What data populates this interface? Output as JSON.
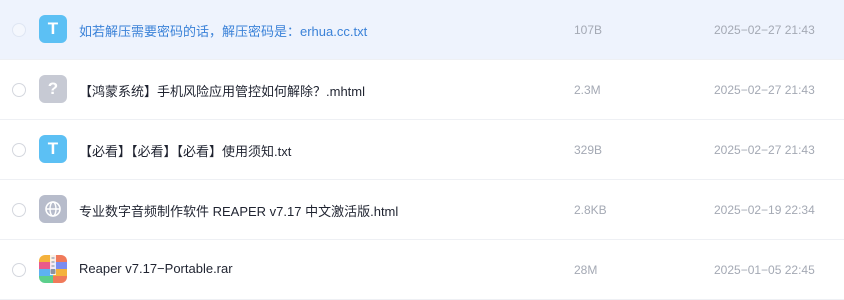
{
  "files": [
    {
      "name": "如若解压需要密码的话，解压密码是：erhua.cc.txt",
      "size": "107B",
      "date": "2025−02−27 21:43",
      "type": "txt",
      "icon_glyph": "T",
      "icon": "text-file-icon"
    },
    {
      "name": "【鸿蒙系统】手机风险应用管控如何解除？.mhtml",
      "size": "2.3M",
      "date": "2025−02−27 21:43",
      "type": "unknown",
      "icon_glyph": "?",
      "icon": "unknown-file-icon"
    },
    {
      "name": "【必看】【必看】【必看】使用须知.txt",
      "size": "329B",
      "date": "2025−02−27 21:43",
      "type": "txt",
      "icon_glyph": "T",
      "icon": "text-file-icon"
    },
    {
      "name": "专业数字音频制作软件 REAPER v7.17 中文激活版.html",
      "size": "2.8KB",
      "date": "2025−02−19 22:34",
      "type": "html",
      "icon_glyph": "",
      "icon": "globe-icon"
    },
    {
      "name": "Reaper v7.17−Portable.rar",
      "size": "28M",
      "date": "2025−01−05 22:45",
      "type": "rar",
      "icon_glyph": "",
      "icon": "archive-icon"
    }
  ],
  "colors": {
    "hover_row_bg": "#eef3fd",
    "hover_name": "#3b82d8",
    "txt_icon": "#5cc0f4",
    "unknown_icon": "#c7cad4",
    "html_icon": "#b7bccb",
    "meta_text": "#a4a9b4"
  }
}
